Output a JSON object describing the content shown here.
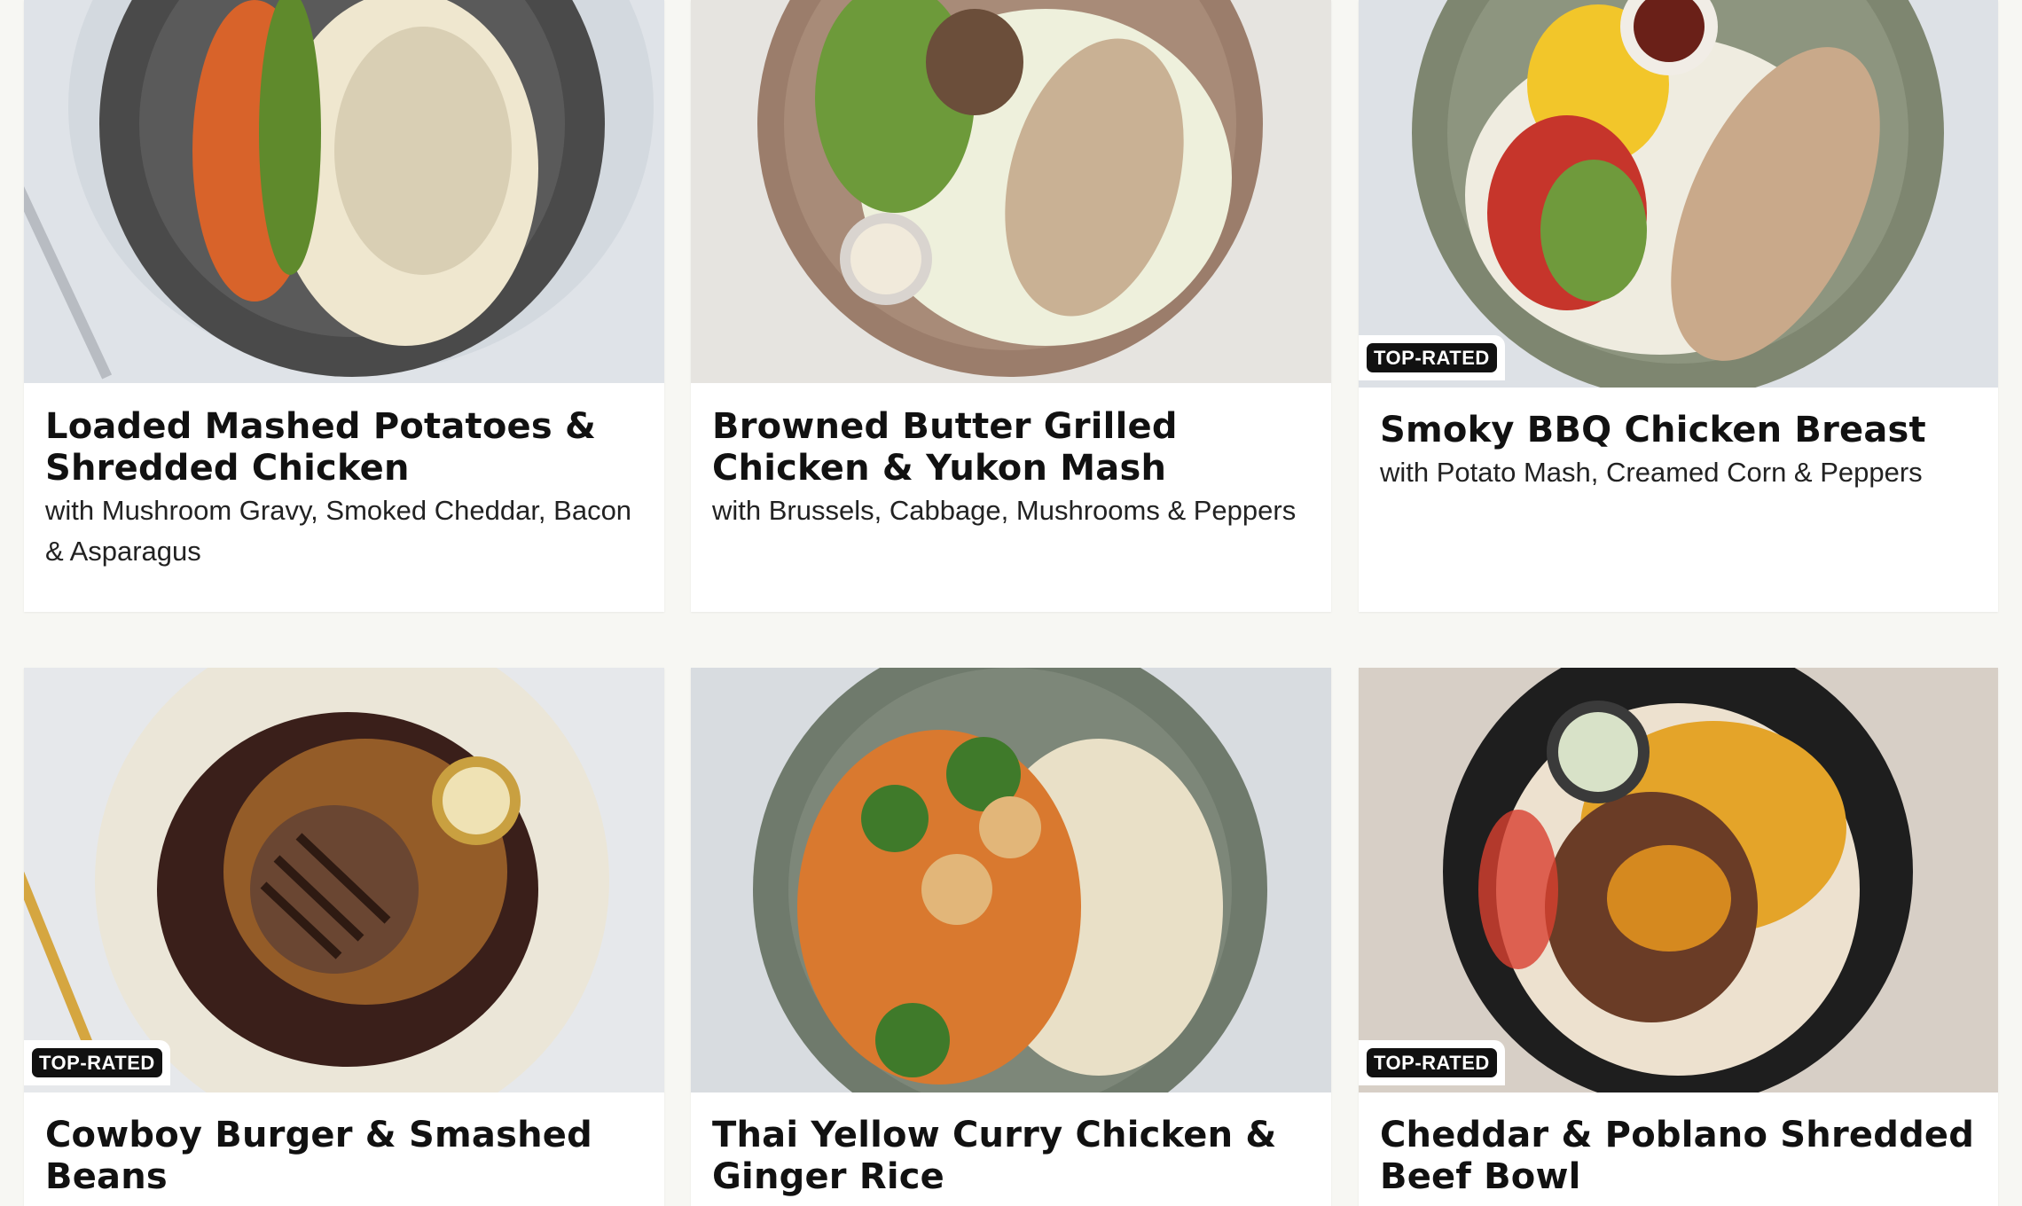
{
  "meals": [
    {
      "title": "Loaded Mashed Potatoes & Shredded Chicken",
      "subtitle": "with Mushroom Gravy, Smoked Cheddar, Bacon & Asparagus",
      "badge": "",
      "plate_color": "#4a4a4a",
      "background_color": "#dfe3e8"
    },
    {
      "title": "Browned Butter Grilled Chicken & Yukon Mash",
      "subtitle": "with Brussels, Cabbage, Mushrooms & Peppers",
      "badge": "",
      "plate_color": "#9b7d6b",
      "background_color": "#e6e4e0"
    },
    {
      "title": "Smoky BBQ Chicken Breast",
      "subtitle": "with Potato Mash, Creamed Corn & Peppers",
      "badge": "TOP-RATED",
      "plate_color": "#7e8670",
      "background_color": "#dde1e6"
    },
    {
      "title": "Cowboy Burger & Smashed Beans",
      "subtitle": "",
      "badge": "TOP-RATED",
      "plate_color": "#ebe6d8",
      "background_color": "#e6e8eb"
    },
    {
      "title": "Thai Yellow Curry Chicken & Ginger Rice",
      "subtitle": "",
      "badge": "",
      "plate_color": "#6f7a6c",
      "background_color": "#d8dce0"
    },
    {
      "title": "Cheddar & Poblano Shredded Beef Bowl",
      "subtitle": "",
      "badge": "TOP-RATED",
      "plate_color": "#1e1e1e",
      "background_color": "#d7cfc6"
    }
  ]
}
